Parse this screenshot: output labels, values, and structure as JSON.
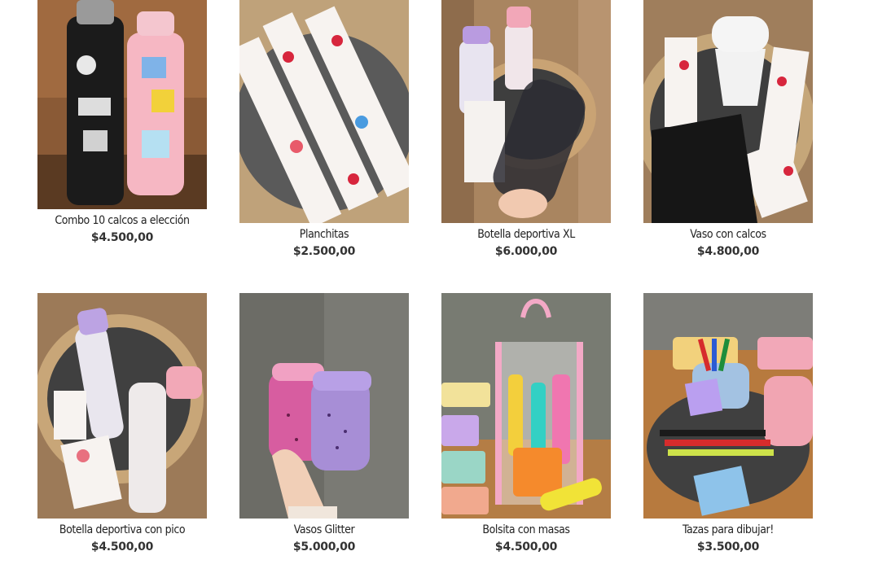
{
  "products": [
    {
      "name": "Combo 10 calcos a elección",
      "price": "$4.500,00",
      "image": "black-and-pink-thermos-with-stickers"
    },
    {
      "name": "Planchitas",
      "price": "$2.500,00",
      "image": "sticker-sheets"
    },
    {
      "name": "Botella deportiva XL",
      "price": "$6.000,00",
      "image": "clear-sport-bottle"
    },
    {
      "name": "Vaso con calcos",
      "price": "$4.800,00",
      "image": "cups-with-sticker-sheets"
    },
    {
      "name": "Botella deportiva con pico",
      "price": "$4.500,00",
      "image": "bottles-with-spout"
    },
    {
      "name": "Vasos Glitter",
      "price": "$5.000,00",
      "image": "glitter-cups"
    },
    {
      "name": "Bolsita con masas",
      "price": "$4.500,00",
      "image": "clear-bag-with-play-dough"
    },
    {
      "name": "Tazas para dibujar!",
      "price": "$3.500,00",
      "image": "mugs-with-markers"
    }
  ]
}
